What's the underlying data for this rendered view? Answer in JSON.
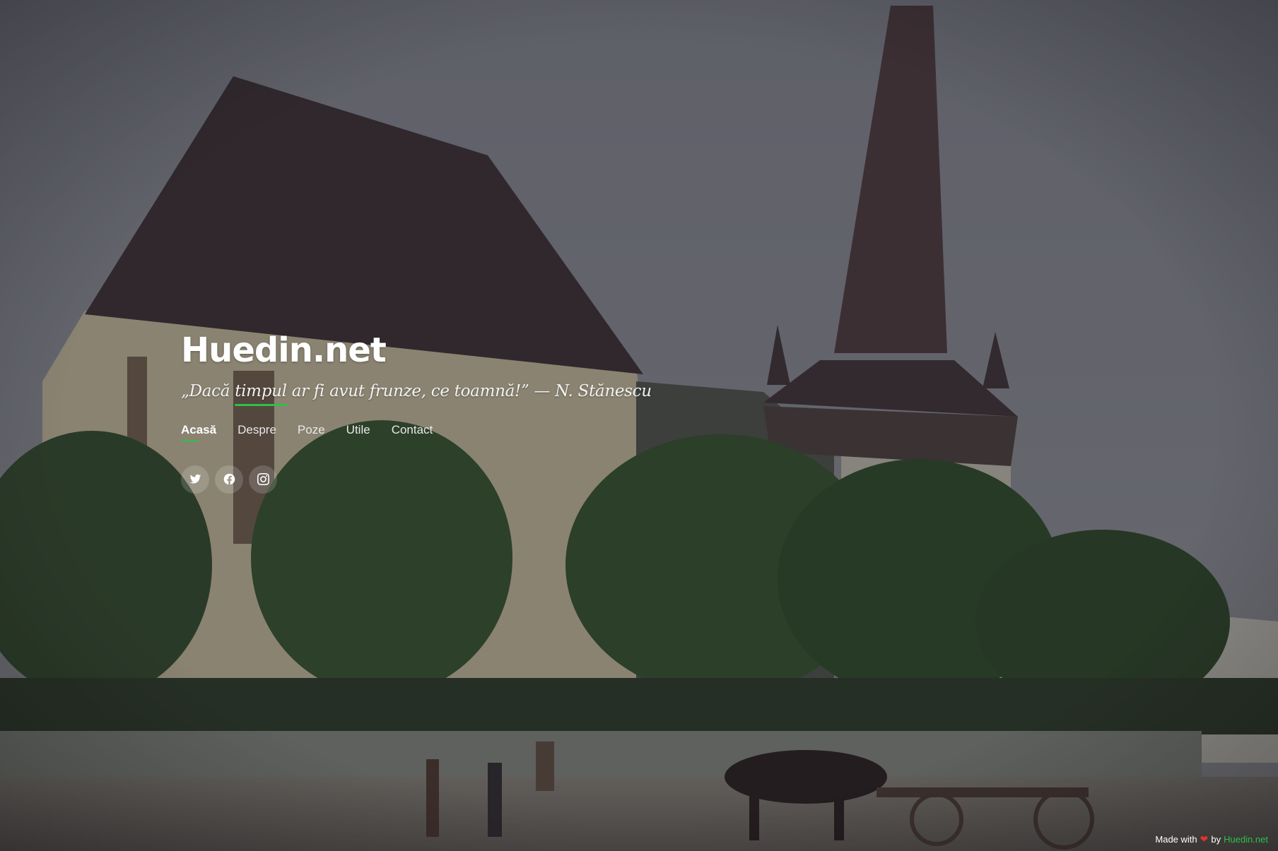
{
  "site": {
    "title": "Huedin.net",
    "tagline_prefix": "„Dacă ",
    "tagline_highlight": "timpul",
    "tagline_suffix": " ar fi avut frunze, ce toamnă!” — N. Stănescu"
  },
  "nav": {
    "items": [
      {
        "label": "Acasă",
        "active": true
      },
      {
        "label": "Despre",
        "active": false
      },
      {
        "label": "Poze",
        "active": false
      },
      {
        "label": "Utile",
        "active": false
      },
      {
        "label": "Contact",
        "active": false
      }
    ]
  },
  "social": {
    "icons": [
      "twitter-icon",
      "facebook-icon",
      "instagram-icon"
    ]
  },
  "footer": {
    "made_with": "Made with",
    "by": "by",
    "brand": "Huedin.net"
  },
  "colors": {
    "accent": "#2fbf4a",
    "heart": "#e0322f",
    "text": "#ffffff"
  }
}
